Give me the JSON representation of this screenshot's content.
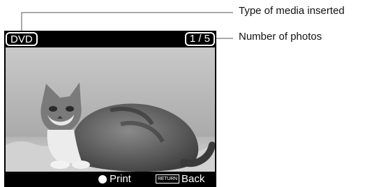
{
  "screen": {
    "media_type": "DVD",
    "photo_count": "1 / 5",
    "photo_subject": "tabby cat lying on a rug",
    "print_label": "Print",
    "return_key": "RETURN",
    "back_label": "Back"
  },
  "callouts": {
    "media_type": "Type of media inserted",
    "photo_count": "Number of photos"
  }
}
